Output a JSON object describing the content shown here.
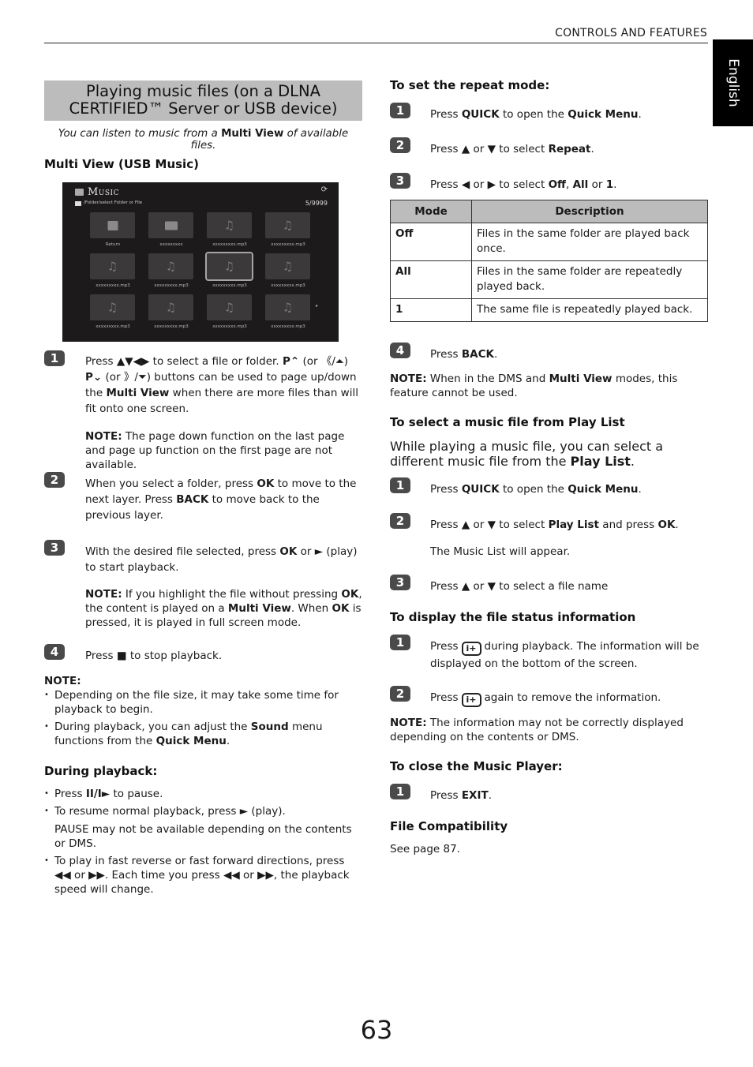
{
  "header": {
    "section": "CONTROLS AND FEATURES",
    "language_tab": "English"
  },
  "left": {
    "title_line1": "Playing music files (on a DLNA",
    "title_line2": "CERTIFIED™ Server or USB device)",
    "intro": {
      "pre": "You can listen to music from a ",
      "bold": "Multi View",
      "post": " of available files."
    },
    "multiview_heading": "Multi View (USB Music)",
    "tv": {
      "title": "Music",
      "path": "/Folder/select Folder or File",
      "count": "5/9999",
      "refresh_icon": "⟳",
      "next_icon": "▸",
      "tiles": [
        {
          "label": "Return",
          "icon": "return-folder"
        },
        {
          "label": "xxxxxxxxx",
          "icon": "folder"
        },
        {
          "label": "xxxxxxxxx.mp3",
          "icon": "music-note"
        },
        {
          "label": "xxxxxxxxx.mp3",
          "icon": "music-note"
        },
        {
          "label": "xxxxxxxxx.mp3",
          "icon": "music-note"
        },
        {
          "label": "xxxxxxxxx.mp3",
          "icon": "music-note"
        },
        {
          "label": "xxxxxxxxx.mp3",
          "icon": "music-note",
          "selected": true
        },
        {
          "label": "xxxxxxxxx.mp3",
          "icon": "music-note"
        },
        {
          "label": "xxxxxxxxx.mp3",
          "icon": "music-note"
        },
        {
          "label": "xxxxxxxxx.mp3",
          "icon": "music-note"
        },
        {
          "label": "xxxxxxxxx.mp3",
          "icon": "music-note"
        },
        {
          "label": "xxxxxxxxx.mp3",
          "icon": "music-note"
        }
      ]
    },
    "steps": [
      {
        "num": "1"
      },
      {
        "num": "2"
      },
      {
        "num": "3"
      },
      {
        "num": "4"
      }
    ],
    "step1": {
      "press": "Press ",
      "arrows": "▲▼◀▶",
      "t1": " to select a file or folder. ",
      "pup": "P⌃",
      "t2": " (or ",
      "pup_alt": "《/⏶",
      "t3": ") ",
      "pdn": "P⌄",
      "t4": " (or ",
      "pdn_alt": "》/⏷",
      "t5": ") buttons can be used to page up/down the ",
      "mv": "Multi View",
      "t6": " when there are more files than will fit onto one screen.",
      "note_label": "NOTE:",
      "note": " The page down function on the last page and page up function on the first page are not available."
    },
    "step2": {
      "t1": "When you select a folder, press ",
      "ok": "OK",
      "t2": " to move to the next layer. Press ",
      "back": "BACK",
      "t3": " to move back to the previous layer."
    },
    "step3": {
      "t1": "With the desired file selected, press ",
      "ok": "OK",
      "t2": " or ",
      "play": "►",
      "t3": " (play) to start playback.",
      "note_label": "NOTE:",
      "n1": " If you highlight the file without pressing ",
      "n_ok": "OK",
      "n2": ", the content is played on a ",
      "n_mv": "Multi View",
      "n3": ". When ",
      "n_ok2": "OK",
      "n4": " is pressed, it is played in full screen mode."
    },
    "step4": {
      "t1": "Press ",
      "stop": "■",
      "t2": " to stop playback."
    },
    "note": {
      "label": "NOTE:",
      "b1": "Depending on the file size, it may take some time for playback to begin.",
      "b2_pre": "During playback, you can adjust the ",
      "b2_bold": "Sound",
      "b2_mid": " menu functions from the ",
      "b2_bold2": "Quick Menu",
      "b2_post": "."
    },
    "during": {
      "heading": "During playback:",
      "i1_pre": "Press ",
      "i1_sym": "II/I►",
      "i1_post": "  to pause.",
      "i2_pre": "To resume normal playback, press ",
      "i2_sym": "►",
      "i2_post": " (play).",
      "i2_extra": "PAUSE may not be available depending on the contents or DMS.",
      "i3_pre": "To play in fast reverse or fast forward directions, press ",
      "rew": "◀◀",
      "or": " or ",
      "ff": "▶▶",
      "i3_mid": ". Each time you press ",
      "i3_post": ", the playback speed will change."
    }
  },
  "right": {
    "repeat_heading": "To set the repeat mode:",
    "r1": {
      "t1": "Press ",
      "b1": "QUICK",
      "t2": " to open the ",
      "b2": "Quick Menu",
      "t3": "."
    },
    "r2": {
      "t1": "Press ",
      "up": "▲",
      "or": " or ",
      "dn": "▼",
      "t2": " to select ",
      "b1": "Repeat",
      "t3": "."
    },
    "r3": {
      "t1": "Press ",
      "lt": "◀",
      "or": " or ",
      "rt": "▶",
      "t2": " to select ",
      "b1": "Off",
      "c": ", ",
      "b2": "All",
      "or2": " or ",
      "b3": "1",
      "t3": "."
    },
    "table": {
      "headers": [
        "Mode",
        "Description"
      ],
      "rows": [
        [
          "Off",
          "Files in the same folder are played back once."
        ],
        [
          "All",
          "Files in the same folder are repeatedly played back."
        ],
        [
          "1",
          "The same file is repeatedly played back."
        ]
      ]
    },
    "r4": {
      "t1": "Press ",
      "b1": "BACK",
      "t2": "."
    },
    "repeat_note": {
      "label": "NOTE:",
      "t1": " When in the DMS and ",
      "b1": "Multi View",
      "t2": " modes, this feature cannot be used."
    },
    "playlist_heading": "To select a music file from Play List",
    "playlist_intro": {
      "t1": "While playing a music file, you can select a different music file from the ",
      "b1": "Play List",
      "t2": "."
    },
    "p1": {
      "t1": "Press ",
      "b1": "QUICK",
      "t2": " to open the ",
      "b2": "Quick Menu",
      "t3": "."
    },
    "p2": {
      "t1": "Press ",
      "up": "▲",
      "or": " or ",
      "dn": "▼",
      "t2": " to select ",
      "b1": "Play List",
      "t3": " and press ",
      "b2": "OK",
      "t4": ".",
      "extra": "The Music List will appear."
    },
    "p3": {
      "t1": "Press ",
      "up": "▲",
      "or": " or ",
      "dn": "▼",
      "t2": " to select a file name"
    },
    "status_heading": "To display the file status information",
    "s1": {
      "t1": "Press",
      "btn": "i+",
      "t2": "during playback. The information will be displayed on the bottom of the screen."
    },
    "s2": {
      "t1": "Press",
      "btn": "i+",
      "t2": "again to remove the information."
    },
    "status_note": {
      "label": "NOTE:",
      "t1": " The information may not be correctly displayed depending on the contents or DMS."
    },
    "close_heading": "To close the Music Player:",
    "c1": {
      "t1": "Press ",
      "b1": "EXIT",
      "t2": "."
    },
    "compat_heading": "File Compatibility",
    "compat_text": "See page 87."
  },
  "page_number": "63"
}
